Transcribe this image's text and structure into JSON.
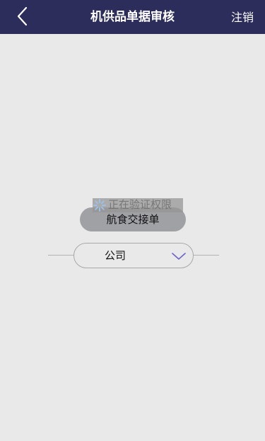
{
  "header": {
    "title": "机供品单据审核",
    "logout_label": "注销",
    "background": "#2c2d5b"
  },
  "icons": {
    "back": "chevron-left-icon",
    "spinner": "spinner-icon",
    "dropdown": "chevron-down-icon"
  },
  "main": {
    "type_button_label": "航食交接单",
    "loading_message": "正在验证权限",
    "company": {
      "selected": "公司"
    }
  },
  "colors": {
    "page_background": "#e9e9e9",
    "button_background": "#9fa1a5",
    "chevron_accent": "#6b63c9"
  }
}
